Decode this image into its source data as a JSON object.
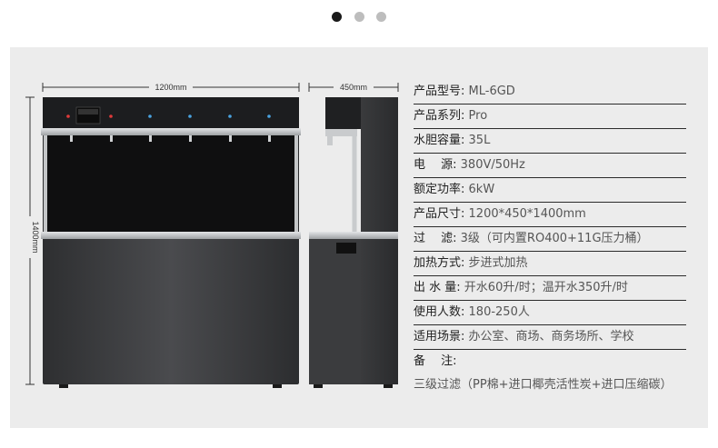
{
  "carousel": {
    "dot_count": 3,
    "active_index": 0
  },
  "dimensions": {
    "width_label": "1200mm",
    "depth_label": "450mm",
    "height_label": "1400mm"
  },
  "specs": [
    {
      "label": "产品型号:",
      "value": "ML-6GD"
    },
    {
      "label": "产品系列:",
      "value": "Pro"
    },
    {
      "label": "水胆容量:",
      "value": "35L"
    },
    {
      "label": "电　 源:",
      "value": "380V/50Hz"
    },
    {
      "label": "额定功率:",
      "value": "6kW"
    },
    {
      "label": "产品尺寸:",
      "value": "1200*450*1400mm"
    },
    {
      "label": "过　 滤:",
      "value": "3级（可内置RO400+11G压力桶）"
    },
    {
      "label": "加热方式:",
      "value": "步进式加热"
    },
    {
      "label": "出 水 量:",
      "value": "开水60升/时；温开水350升/时"
    },
    {
      "label": "使用人数:",
      "value": "180-250人"
    },
    {
      "label": "适用场景:",
      "value": "办公室、商场、商务场所、学校"
    },
    {
      "label": "备　 注:",
      "value": ""
    }
  ],
  "note": "三级过滤（PP棉+进口椰壳活性炭+进口压缩碳）",
  "colors": {
    "panel_bg": "#ececec",
    "body_dark": "#3c3d3f",
    "window_black": "#111111",
    "steel": "#b9bcbf"
  }
}
